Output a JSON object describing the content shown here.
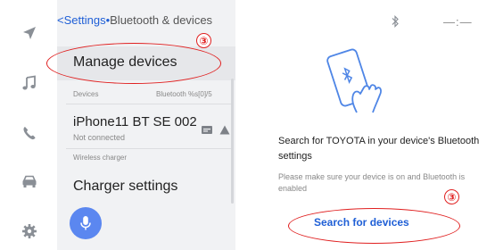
{
  "breadcrumb": {
    "parent": "<Settings",
    "separator": "•",
    "current": "Bluetooth & devices"
  },
  "panel": {
    "manage_label": "Manage devices",
    "devices_section_label": "Devices",
    "bluetooth_count_label": "Bluetooth %s[0]/5",
    "device": {
      "name": "iPhone11 BT SE 002",
      "status": "Not connected"
    },
    "wireless_charger_label": "Wireless charger",
    "charger_settings_label": "Charger settings"
  },
  "status_bar": {
    "bluetooth_icon": "bluetooth-icon",
    "time": "—:—"
  },
  "right": {
    "illustration_icon": "phone-bluetooth-illustration",
    "prompt": "Search for TOYOTA in your device's Bluetooth settings",
    "note": "Please make sure your device is on and Bluetooth is enabled",
    "search_button_label": "Search for devices"
  },
  "rail_icons": [
    "navigation-icon",
    "music-icon",
    "phone-icon",
    "car-icon",
    "settings-icon"
  ],
  "annotations": {
    "marker_1": "③",
    "marker_2": "③"
  },
  "colors": {
    "accent": "#1f5fd6",
    "annotation": "#e02020",
    "mic_button": "#5b87f0"
  }
}
